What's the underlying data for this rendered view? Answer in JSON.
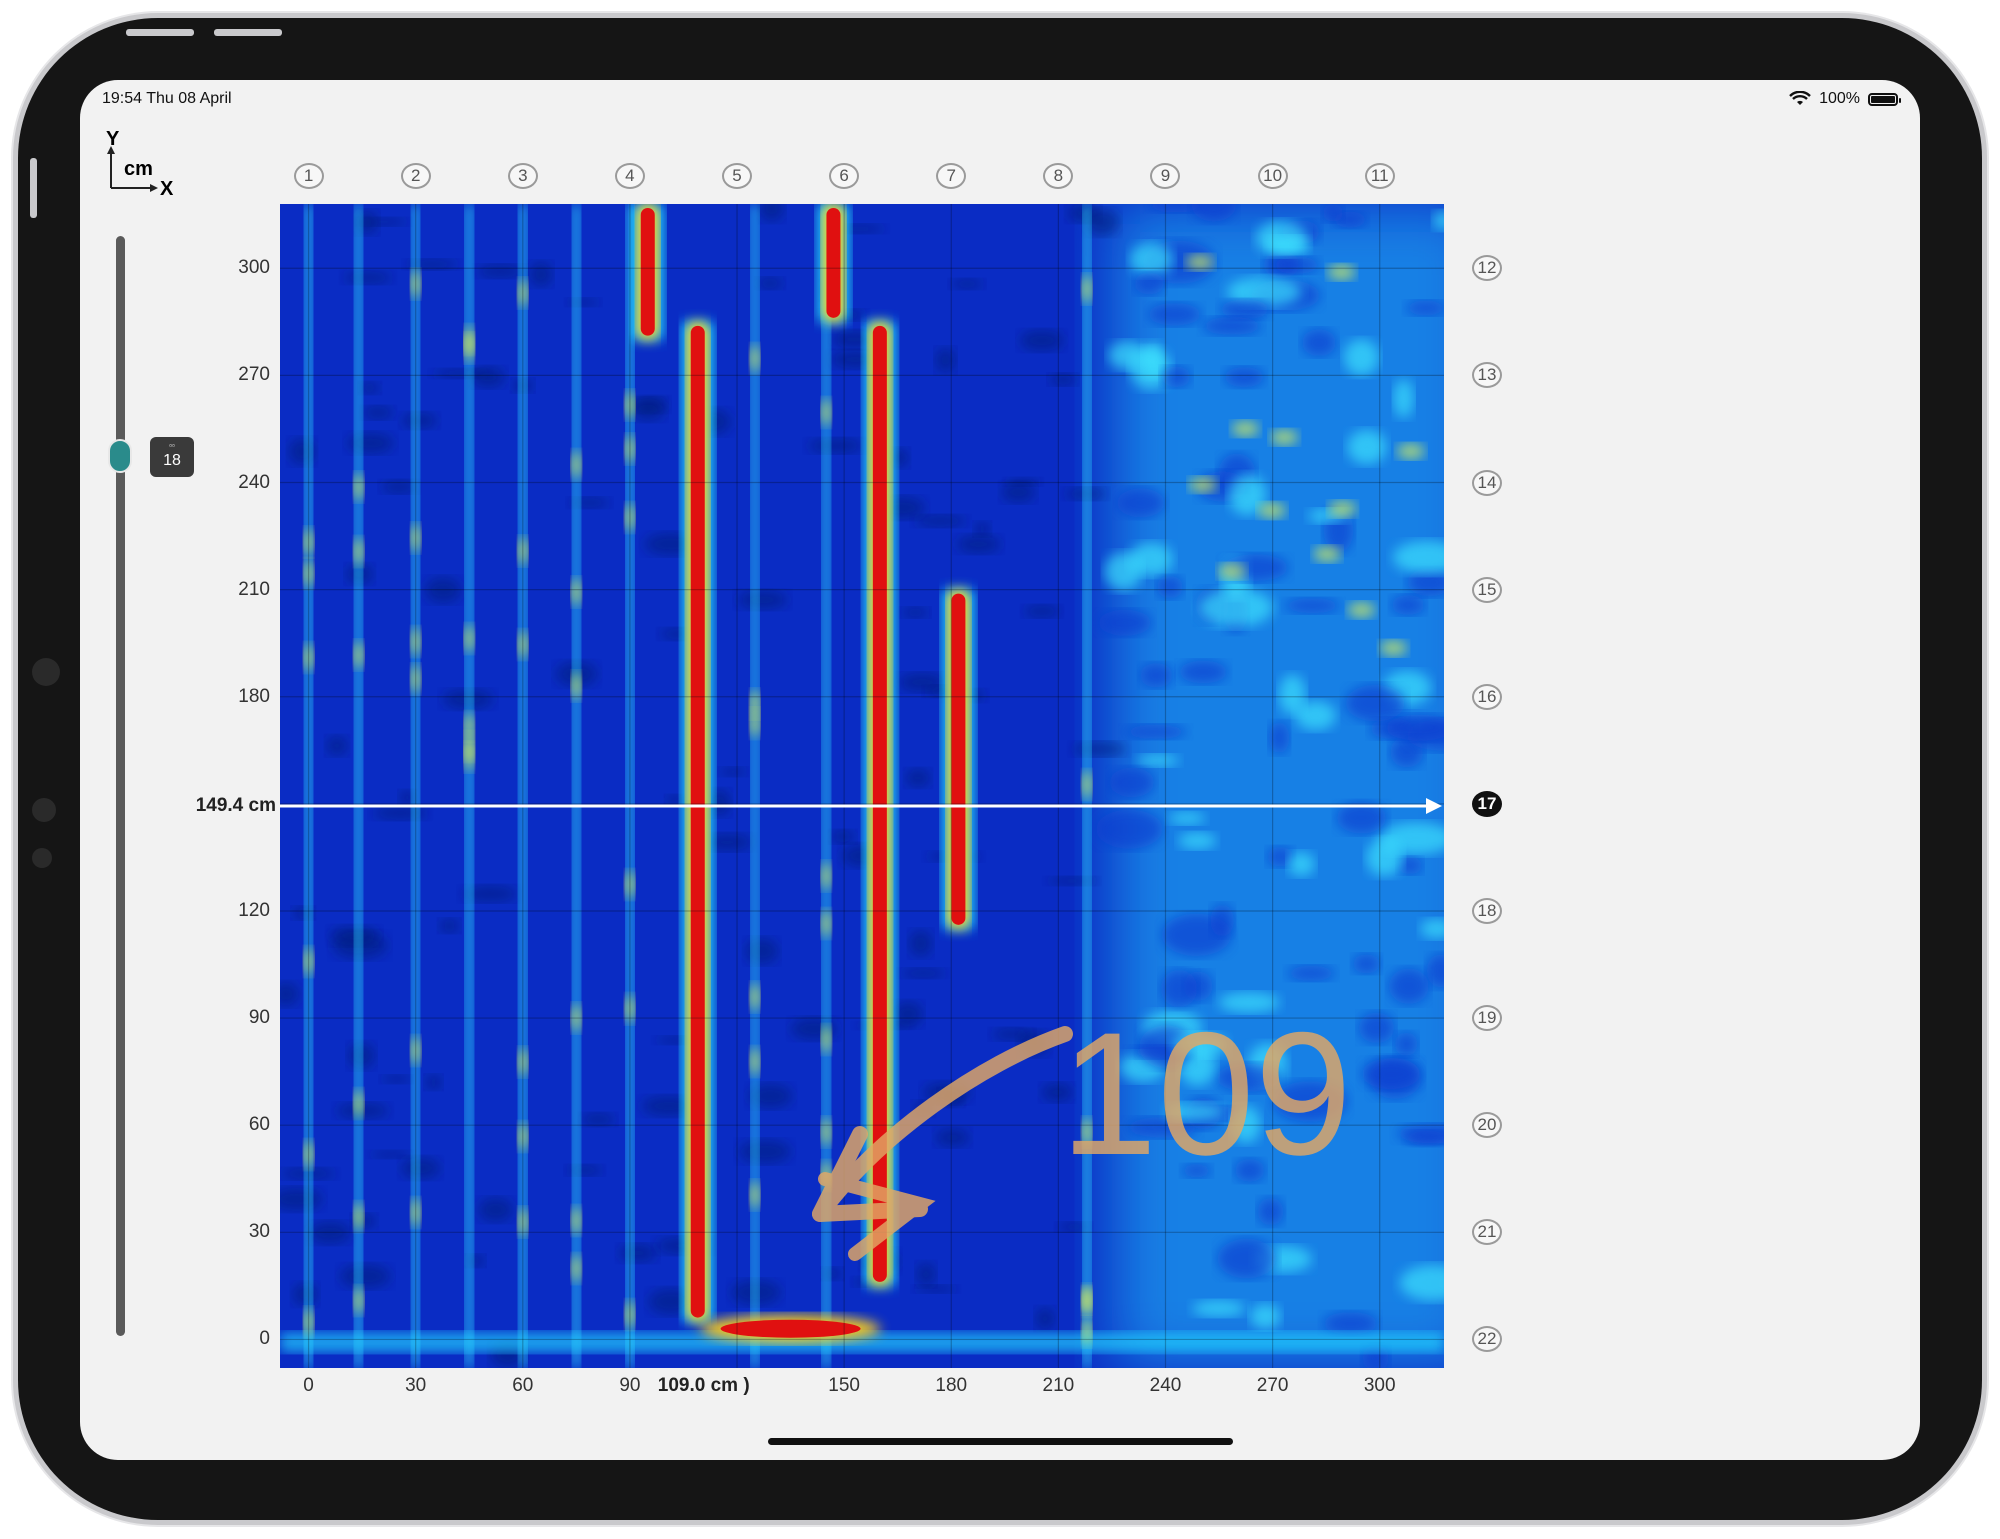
{
  "status_bar": {
    "time_date": "19:54 Thu 08 April",
    "battery": "100%"
  },
  "axes_legend": {
    "y": "Y",
    "unit": "cm",
    "x": "X"
  },
  "depth_slider": {
    "value_label": "18",
    "value": 18,
    "level_fraction": 0.2
  },
  "crosshair": {
    "y_readout": "149.4 cm",
    "x_readout": "109.0 cm )",
    "y_value": 149.4,
    "x_value": 109.0
  },
  "top_markers": [
    "1",
    "2",
    "3",
    "4",
    "5",
    "6",
    "7",
    "8",
    "9",
    "10",
    "11"
  ],
  "right_markers": [
    "12",
    "13",
    "14",
    "15",
    "16",
    "17",
    "18",
    "19",
    "20",
    "21",
    "22"
  ],
  "active_marker": "17",
  "annotation": {
    "text": "109"
  },
  "colors": {
    "heat_low": "#0a2cc4",
    "heat_mid": "#00c8ff",
    "heat_high": "#e01010",
    "annotation": "#e0a860"
  },
  "chart_data": {
    "type": "heatmap",
    "title": "",
    "xlabel": "X",
    "ylabel": "Y",
    "unit": "cm",
    "xlim": [
      -8,
      318
    ],
    "ylim": [
      -8,
      318
    ],
    "x_ticks": [
      "0",
      "30",
      "60",
      "90",
      "150",
      "180",
      "210",
      "240",
      "270",
      "300"
    ],
    "x_tick_values": [
      0,
      30,
      60,
      90,
      150,
      180,
      210,
      240,
      270,
      300
    ],
    "y_ticks": [
      "300",
      "270",
      "240",
      "210",
      "180",
      "120",
      "90",
      "60",
      "30",
      "0"
    ],
    "y_tick_values": [
      300,
      270,
      240,
      210,
      180,
      120,
      90,
      60,
      30,
      0
    ],
    "strong_reflections": [
      {
        "x": 109,
        "y_from": 5,
        "y_to": 285
      },
      {
        "x": 160,
        "y_from": 15,
        "y_to": 285
      },
      {
        "x": 182,
        "y_from": 115,
        "y_to": 210
      },
      {
        "x": 95,
        "y_from": 280,
        "y_to": 318
      },
      {
        "x": 147,
        "y_from": 285,
        "y_to": 318
      },
      {
        "x": 135,
        "y_from": 0,
        "y_to": 6
      }
    ],
    "weak_reflections_x": [
      0,
      14,
      30,
      45,
      60,
      75,
      90,
      125,
      145,
      218
    ]
  }
}
